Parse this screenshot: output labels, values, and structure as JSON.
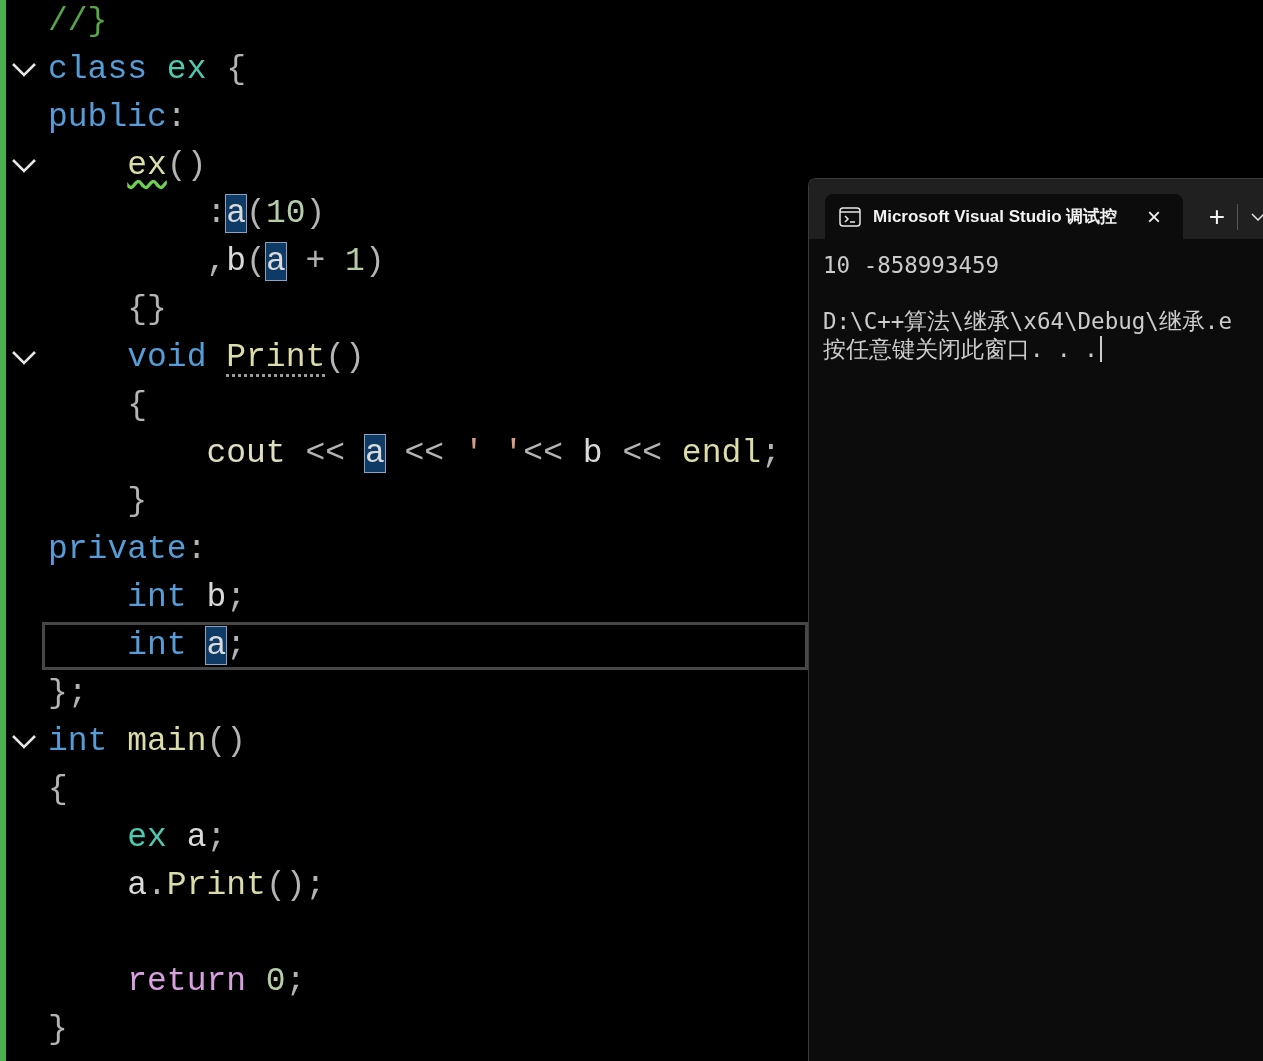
{
  "editor": {
    "lines": [
      {
        "foldable": false,
        "current": false,
        "tokens": [
          {
            "kind": "comment",
            "text": "//}"
          }
        ]
      },
      {
        "foldable": true,
        "current": false,
        "tokens": [
          {
            "kind": "keyword",
            "text": "class"
          },
          {
            "kind": "type",
            "text": " ex"
          },
          {
            "kind": "plain",
            "text": " {"
          }
        ]
      },
      {
        "foldable": false,
        "current": false,
        "tokens": [
          {
            "kind": "keyword",
            "text": "public"
          },
          {
            "kind": "plain",
            "text": ":"
          }
        ]
      },
      {
        "foldable": true,
        "current": false,
        "tokens": [
          {
            "kind": "function",
            "text": "    ex",
            "squiggle": true
          },
          {
            "kind": "plain",
            "text": "()"
          }
        ]
      },
      {
        "foldable": false,
        "current": false,
        "tokens": [
          {
            "kind": "plain",
            "text": "        :"
          },
          {
            "kind": "variable",
            "text": "a",
            "highlighted": true
          },
          {
            "kind": "plain",
            "text": "("
          },
          {
            "kind": "number",
            "text": "10"
          },
          {
            "kind": "plain",
            "text": ")"
          }
        ]
      },
      {
        "foldable": false,
        "current": false,
        "tokens": [
          {
            "kind": "plain",
            "text": "        ,"
          },
          {
            "kind": "variable",
            "text": "b"
          },
          {
            "kind": "plain",
            "text": "("
          },
          {
            "kind": "variable",
            "text": "a",
            "highlighted": true
          },
          {
            "kind": "plain",
            "text": " + "
          },
          {
            "kind": "number",
            "text": "1"
          },
          {
            "kind": "plain",
            "text": ")"
          }
        ]
      },
      {
        "foldable": false,
        "current": false,
        "tokens": [
          {
            "kind": "plain",
            "text": "    {}"
          }
        ]
      },
      {
        "foldable": true,
        "current": false,
        "tokens": [
          {
            "kind": "keyword",
            "text": "    void"
          },
          {
            "kind": "function",
            "text": " Print",
            "dotted": true
          },
          {
            "kind": "plain",
            "text": "()"
          }
        ]
      },
      {
        "foldable": false,
        "current": false,
        "tokens": [
          {
            "kind": "plain",
            "text": "    {"
          }
        ]
      },
      {
        "foldable": false,
        "current": false,
        "tokens": [
          {
            "kind": "stream",
            "text": "        cout"
          },
          {
            "kind": "plain",
            "text": " << "
          },
          {
            "kind": "variable",
            "text": "a",
            "highlighted": true
          },
          {
            "kind": "plain",
            "text": " << "
          },
          {
            "kind": "string",
            "text": "' '"
          },
          {
            "kind": "plain",
            "text": "<< "
          },
          {
            "kind": "variable",
            "text": "b"
          },
          {
            "kind": "plain",
            "text": " << "
          },
          {
            "kind": "function",
            "text": "endl"
          },
          {
            "kind": "plain",
            "text": ";"
          }
        ]
      },
      {
        "foldable": false,
        "current": false,
        "tokens": [
          {
            "kind": "plain",
            "text": "    }"
          }
        ]
      },
      {
        "foldable": false,
        "current": false,
        "tokens": [
          {
            "kind": "keyword",
            "text": "private"
          },
          {
            "kind": "plain",
            "text": ":"
          }
        ]
      },
      {
        "foldable": false,
        "current": false,
        "tokens": [
          {
            "kind": "keyword",
            "text": "    int"
          },
          {
            "kind": "variable",
            "text": " b"
          },
          {
            "kind": "plain",
            "text": ";"
          }
        ]
      },
      {
        "foldable": false,
        "current": true,
        "tokens": [
          {
            "kind": "keyword",
            "text": "    int "
          },
          {
            "kind": "variable",
            "text": "a",
            "highlighted": true
          },
          {
            "kind": "plain",
            "text": ";"
          }
        ]
      },
      {
        "foldable": false,
        "current": false,
        "tokens": [
          {
            "kind": "plain",
            "text": "};"
          }
        ]
      },
      {
        "foldable": true,
        "current": false,
        "tokens": [
          {
            "kind": "keyword",
            "text": "int"
          },
          {
            "kind": "function",
            "text": " main"
          },
          {
            "kind": "plain",
            "text": "()"
          }
        ]
      },
      {
        "foldable": false,
        "current": false,
        "tokens": [
          {
            "kind": "plain",
            "text": "{"
          }
        ]
      },
      {
        "foldable": false,
        "current": false,
        "tokens": [
          {
            "kind": "type",
            "text": "    ex"
          },
          {
            "kind": "variable",
            "text": " a"
          },
          {
            "kind": "plain",
            "text": ";"
          }
        ]
      },
      {
        "foldable": false,
        "current": false,
        "tokens": [
          {
            "kind": "variable",
            "text": "    a"
          },
          {
            "kind": "plain",
            "text": "."
          },
          {
            "kind": "function",
            "text": "Print"
          },
          {
            "kind": "plain",
            "text": "();"
          }
        ]
      },
      {
        "foldable": false,
        "current": false
      },
      {
        "foldable": false,
        "current": false,
        "tokens": [
          {
            "kind": "control",
            "text": "    return"
          },
          {
            "kind": "number",
            "text": " 0"
          },
          {
            "kind": "plain",
            "text": ";"
          }
        ]
      },
      {
        "foldable": false,
        "current": false,
        "tokens": [
          {
            "kind": "plain",
            "text": "}"
          }
        ]
      }
    ]
  },
  "terminal": {
    "tab": {
      "title": "Microsoft Visual Studio 调试控",
      "close": "×"
    },
    "new_tab": "+",
    "output_blocks": [
      [
        "10 -858993459"
      ],
      [
        "D:\\C++算法\\继承\\x64\\Debug\\继承.e",
        "按任意键关闭此窗口. . ."
      ]
    ]
  }
}
